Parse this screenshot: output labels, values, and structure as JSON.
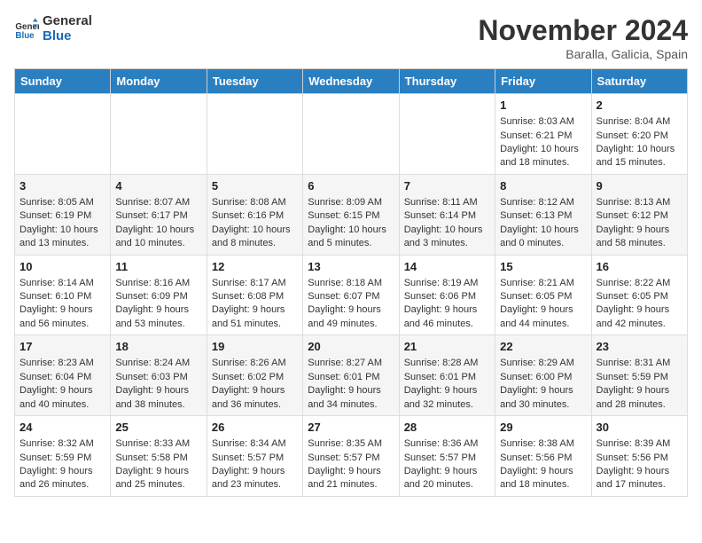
{
  "logo": {
    "text_general": "General",
    "text_blue": "Blue"
  },
  "title": "November 2024",
  "location": "Baralla, Galicia, Spain",
  "weekdays": [
    "Sunday",
    "Monday",
    "Tuesday",
    "Wednesday",
    "Thursday",
    "Friday",
    "Saturday"
  ],
  "weeks": [
    [
      {
        "day": "",
        "info": ""
      },
      {
        "day": "",
        "info": ""
      },
      {
        "day": "",
        "info": ""
      },
      {
        "day": "",
        "info": ""
      },
      {
        "day": "",
        "info": ""
      },
      {
        "day": "1",
        "info": "Sunrise: 8:03 AM\nSunset: 6:21 PM\nDaylight: 10 hours and 18 minutes."
      },
      {
        "day": "2",
        "info": "Sunrise: 8:04 AM\nSunset: 6:20 PM\nDaylight: 10 hours and 15 minutes."
      }
    ],
    [
      {
        "day": "3",
        "info": "Sunrise: 8:05 AM\nSunset: 6:19 PM\nDaylight: 10 hours and 13 minutes."
      },
      {
        "day": "4",
        "info": "Sunrise: 8:07 AM\nSunset: 6:17 PM\nDaylight: 10 hours and 10 minutes."
      },
      {
        "day": "5",
        "info": "Sunrise: 8:08 AM\nSunset: 6:16 PM\nDaylight: 10 hours and 8 minutes."
      },
      {
        "day": "6",
        "info": "Sunrise: 8:09 AM\nSunset: 6:15 PM\nDaylight: 10 hours and 5 minutes."
      },
      {
        "day": "7",
        "info": "Sunrise: 8:11 AM\nSunset: 6:14 PM\nDaylight: 10 hours and 3 minutes."
      },
      {
        "day": "8",
        "info": "Sunrise: 8:12 AM\nSunset: 6:13 PM\nDaylight: 10 hours and 0 minutes."
      },
      {
        "day": "9",
        "info": "Sunrise: 8:13 AM\nSunset: 6:12 PM\nDaylight: 9 hours and 58 minutes."
      }
    ],
    [
      {
        "day": "10",
        "info": "Sunrise: 8:14 AM\nSunset: 6:10 PM\nDaylight: 9 hours and 56 minutes."
      },
      {
        "day": "11",
        "info": "Sunrise: 8:16 AM\nSunset: 6:09 PM\nDaylight: 9 hours and 53 minutes."
      },
      {
        "day": "12",
        "info": "Sunrise: 8:17 AM\nSunset: 6:08 PM\nDaylight: 9 hours and 51 minutes."
      },
      {
        "day": "13",
        "info": "Sunrise: 8:18 AM\nSunset: 6:07 PM\nDaylight: 9 hours and 49 minutes."
      },
      {
        "day": "14",
        "info": "Sunrise: 8:19 AM\nSunset: 6:06 PM\nDaylight: 9 hours and 46 minutes."
      },
      {
        "day": "15",
        "info": "Sunrise: 8:21 AM\nSunset: 6:05 PM\nDaylight: 9 hours and 44 minutes."
      },
      {
        "day": "16",
        "info": "Sunrise: 8:22 AM\nSunset: 6:05 PM\nDaylight: 9 hours and 42 minutes."
      }
    ],
    [
      {
        "day": "17",
        "info": "Sunrise: 8:23 AM\nSunset: 6:04 PM\nDaylight: 9 hours and 40 minutes."
      },
      {
        "day": "18",
        "info": "Sunrise: 8:24 AM\nSunset: 6:03 PM\nDaylight: 9 hours and 38 minutes."
      },
      {
        "day": "19",
        "info": "Sunrise: 8:26 AM\nSunset: 6:02 PM\nDaylight: 9 hours and 36 minutes."
      },
      {
        "day": "20",
        "info": "Sunrise: 8:27 AM\nSunset: 6:01 PM\nDaylight: 9 hours and 34 minutes."
      },
      {
        "day": "21",
        "info": "Sunrise: 8:28 AM\nSunset: 6:01 PM\nDaylight: 9 hours and 32 minutes."
      },
      {
        "day": "22",
        "info": "Sunrise: 8:29 AM\nSunset: 6:00 PM\nDaylight: 9 hours and 30 minutes."
      },
      {
        "day": "23",
        "info": "Sunrise: 8:31 AM\nSunset: 5:59 PM\nDaylight: 9 hours and 28 minutes."
      }
    ],
    [
      {
        "day": "24",
        "info": "Sunrise: 8:32 AM\nSunset: 5:59 PM\nDaylight: 9 hours and 26 minutes."
      },
      {
        "day": "25",
        "info": "Sunrise: 8:33 AM\nSunset: 5:58 PM\nDaylight: 9 hours and 25 minutes."
      },
      {
        "day": "26",
        "info": "Sunrise: 8:34 AM\nSunset: 5:57 PM\nDaylight: 9 hours and 23 minutes."
      },
      {
        "day": "27",
        "info": "Sunrise: 8:35 AM\nSunset: 5:57 PM\nDaylight: 9 hours and 21 minutes."
      },
      {
        "day": "28",
        "info": "Sunrise: 8:36 AM\nSunset: 5:57 PM\nDaylight: 9 hours and 20 minutes."
      },
      {
        "day": "29",
        "info": "Sunrise: 8:38 AM\nSunset: 5:56 PM\nDaylight: 9 hours and 18 minutes."
      },
      {
        "day": "30",
        "info": "Sunrise: 8:39 AM\nSunset: 5:56 PM\nDaylight: 9 hours and 17 minutes."
      }
    ]
  ]
}
